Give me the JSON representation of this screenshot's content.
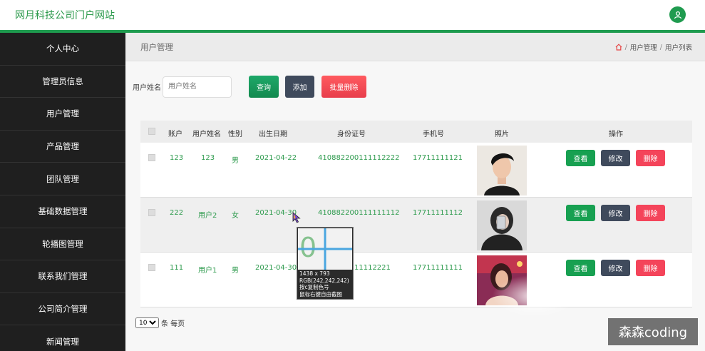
{
  "app": {
    "title": "网月科技公司门户网站"
  },
  "sidebar": {
    "items": [
      {
        "label": "个人中心"
      },
      {
        "label": "管理员信息"
      },
      {
        "label": "用户管理"
      },
      {
        "label": "产品管理"
      },
      {
        "label": "团队管理"
      },
      {
        "label": "基础数据管理"
      },
      {
        "label": "轮播图管理"
      },
      {
        "label": "联系我们管理"
      },
      {
        "label": "公司简介管理"
      },
      {
        "label": "新闻管理"
      }
    ]
  },
  "page": {
    "title": "用户管理",
    "breadcrumb": [
      "用户管理",
      "用户列表"
    ],
    "breadcrumb_sep": "/"
  },
  "search": {
    "label": "用户姓名",
    "placeholder": "用户姓名",
    "query_label": "查询",
    "add_label": "添加",
    "batch_delete_label": "批量删除"
  },
  "table": {
    "headers": [
      "账户",
      "用户姓名",
      "性别",
      "出生日期",
      "身份证号",
      "手机号",
      "照片",
      "操作"
    ],
    "rows": [
      {
        "account": "123",
        "name": "123",
        "gender": "男",
        "birth": "2021-04-22",
        "id_card": "410882200111112222",
        "phone": "17711111121"
      },
      {
        "account": "222",
        "name": "用户2",
        "gender": "女",
        "birth": "2021-04-30",
        "id_card": "410882200111111112",
        "phone": "17711111112"
      },
      {
        "account": "111",
        "name": "用户1",
        "gender": "男",
        "birth": "2021-04-30",
        "id_card": "11112221",
        "phone": "17711111111"
      }
    ],
    "actions": {
      "view": "查看",
      "edit": "修改",
      "delete": "删除"
    }
  },
  "pager": {
    "page_size": "10",
    "suffix": "条 每页"
  },
  "color_picker": {
    "size": "1438 x 793",
    "rgb": "RGB(242,242,242)",
    "hint1": "按c复制色号",
    "hint2": "鼠标右键自由截图"
  },
  "watermark": {
    "text": "森森coding"
  },
  "colors": {
    "brand_green": "#1f9b4f",
    "sidebar_bg": "#1f1f1f",
    "delete_red": "#f4445a",
    "edit_slate": "#3f4a5c"
  }
}
